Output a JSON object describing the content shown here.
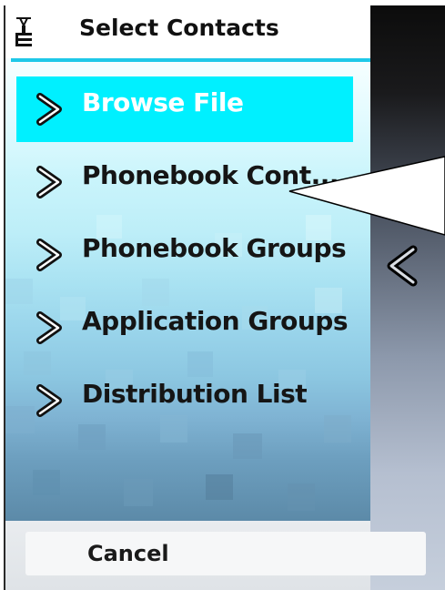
{
  "header": {
    "title": "Select Contacts",
    "icon": "contacts-select-icon"
  },
  "menu": {
    "items": [
      {
        "label": "Browse File",
        "selected": true,
        "icon": "chevron-right-icon"
      },
      {
        "label": "Phonebook Cont...",
        "selected": false,
        "icon": "chevron-right-icon"
      },
      {
        "label": "Phonebook Groups",
        "selected": false,
        "icon": "chevron-right-icon"
      },
      {
        "label": "Application Groups",
        "selected": false,
        "icon": "chevron-right-icon"
      },
      {
        "label": "Distribution List",
        "selected": false,
        "icon": "chevron-right-icon"
      }
    ]
  },
  "softkeys": {
    "cancel_label": "Cancel"
  },
  "side_panel": {
    "icon": "chevron-left-icon"
  },
  "colors": {
    "selection": "#00f0ff",
    "header_rule": "#1ec8e8",
    "text": "#151515"
  }
}
